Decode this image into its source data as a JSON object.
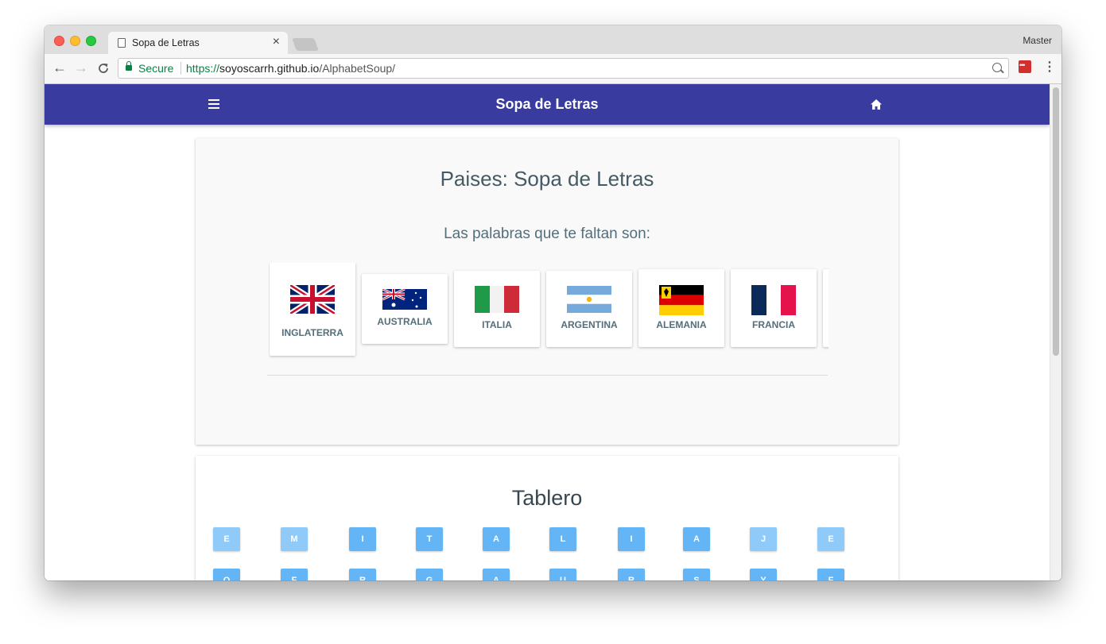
{
  "browser": {
    "tab_title": "Sopa de Letras",
    "tab_close": "×",
    "profile_name": "Master",
    "secure_label": "Secure",
    "url_scheme": "https://",
    "url_host": "soyoscarrh.github.io",
    "url_path": "/AlphabetSoup/",
    "back_icon": "←",
    "forward_icon": "→",
    "reload_icon": "C",
    "menu_icon": "⋮"
  },
  "appbar": {
    "title": "Sopa de Letras",
    "color": "#3a3b9f"
  },
  "words_card": {
    "title": "Paises: Sopa de Letras",
    "subtitle": "Las palabras que te faltan son:",
    "countries": [
      {
        "label": "INGLATERRA",
        "flag": "uk-flag"
      },
      {
        "label": "AUSTRALIA",
        "flag": "australia-flag"
      },
      {
        "label": "ITALIA",
        "flag": "italy-flag"
      },
      {
        "label": "ARGENTINA",
        "flag": "argentina-flag"
      },
      {
        "label": "ALEMANIA",
        "flag": "germany-flag"
      },
      {
        "label": "FRANCIA",
        "flag": "france-flag"
      }
    ]
  },
  "board": {
    "title": "Tablero",
    "rows": [
      [
        "E",
        "M",
        "I",
        "T",
        "A",
        "L",
        "I",
        "A",
        "J",
        "E"
      ],
      [
        "O",
        "F",
        "R",
        "G",
        "A",
        "U",
        "R",
        "S",
        "Y",
        "F"
      ]
    ],
    "colors": {
      "light": "#90caf9",
      "dark": "#64b5f6"
    }
  }
}
